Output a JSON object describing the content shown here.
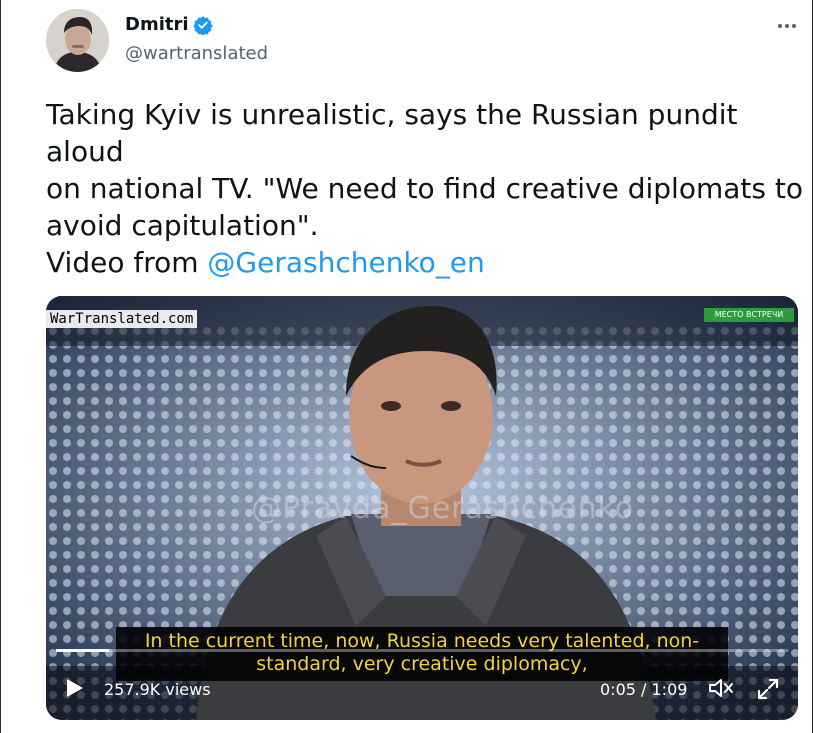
{
  "author": {
    "display_name": "Dmitri",
    "handle": "@wartranslated",
    "verified": true,
    "avatar_icon": "avatar-photo"
  },
  "tweet": {
    "text": "Taking Kyiv is unrealistic, says the Russian pundit aloud\non national TV. \"We need to find creative diplomats to\navoid capitulation\".",
    "video_prefix": "Video from ",
    "mention": "@Gerashchenko_en"
  },
  "media": {
    "corner_watermark": "WarTranslated.com",
    "channel_badge": "МЕСТО ВСТРЕЧИ",
    "overlay_watermark": "@Pravda_Gerashchenko",
    "subtitle_line1": "In the current time, now, Russia needs very talented, non-",
    "subtitle_line2": "standard, very creative diplomacy,",
    "views": "257.9K views",
    "time": "0:05 / 1:09",
    "progress_fraction": 0.0725
  },
  "colors": {
    "accent": "#1d9bf0",
    "subtitle_text": "#f5d23c",
    "badge_green": "#2e9a3c"
  },
  "icons": {
    "more": "more-horizontal-icon",
    "play": "play-icon",
    "mute": "volume-muted-icon",
    "fullscreen": "fullscreen-icon",
    "verified": "verified-badge-icon"
  }
}
